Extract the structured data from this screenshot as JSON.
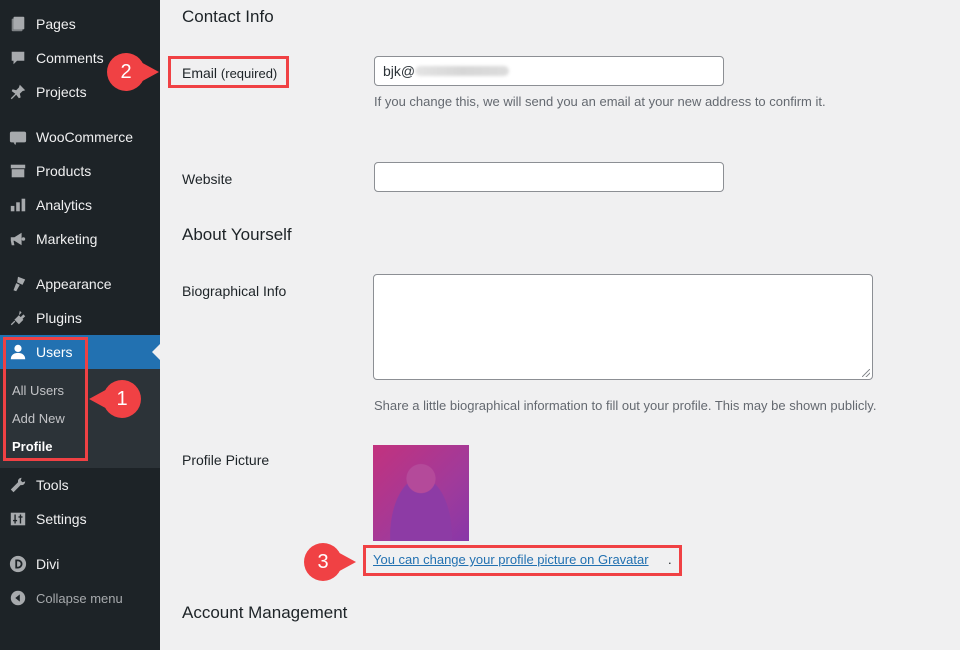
{
  "sidebar": {
    "items": [
      {
        "label": "Pages",
        "icon": "pages-icon"
      },
      {
        "label": "Comments",
        "icon": "comments-icon"
      },
      {
        "label": "Projects",
        "icon": "pin-icon"
      },
      {
        "label": "WooCommerce",
        "icon": "woocommerce-icon"
      },
      {
        "label": "Products",
        "icon": "archive-icon"
      },
      {
        "label": "Analytics",
        "icon": "bar-chart-icon"
      },
      {
        "label": "Marketing",
        "icon": "megaphone-icon"
      },
      {
        "label": "Appearance",
        "icon": "paintbrush-icon"
      },
      {
        "label": "Plugins",
        "icon": "plug-icon"
      },
      {
        "label": "Users",
        "icon": "user-icon",
        "active": true
      },
      {
        "label": "Tools",
        "icon": "wrench-icon"
      },
      {
        "label": "Settings",
        "icon": "sliders-icon"
      },
      {
        "label": "Divi",
        "icon": "divi-icon"
      },
      {
        "label": "Collapse menu",
        "icon": "collapse-icon"
      }
    ],
    "users_submenu": [
      {
        "label": "All Users"
      },
      {
        "label": "Add New"
      },
      {
        "label": "Profile",
        "current": true
      }
    ]
  },
  "callouts": {
    "one": "1",
    "two": "2",
    "three": "3",
    "color": "#f04144"
  },
  "main": {
    "contact_heading": "Contact Info",
    "email_label": "Email",
    "email_required": "(required)",
    "email_value_visible": "bjk@",
    "email_desc": "If you change this, we will send you an email at your new address to confirm it.",
    "website_label": "Website",
    "website_value": "",
    "about_heading": "About Yourself",
    "bio_label": "Biographical Info",
    "bio_value": "",
    "bio_desc": "Share a little biographical information to fill out your profile. This may be shown publicly.",
    "picture_label": "Profile Picture",
    "gravatar_link": "You can change your profile picture on Gravatar",
    "gravatar_period": ".",
    "account_heading": "Account Management"
  },
  "colors": {
    "sidebar_bg": "#1d2327",
    "active_bg": "#2271b1",
    "link": "#2271b1",
    "page_bg": "#f0f0f1"
  }
}
